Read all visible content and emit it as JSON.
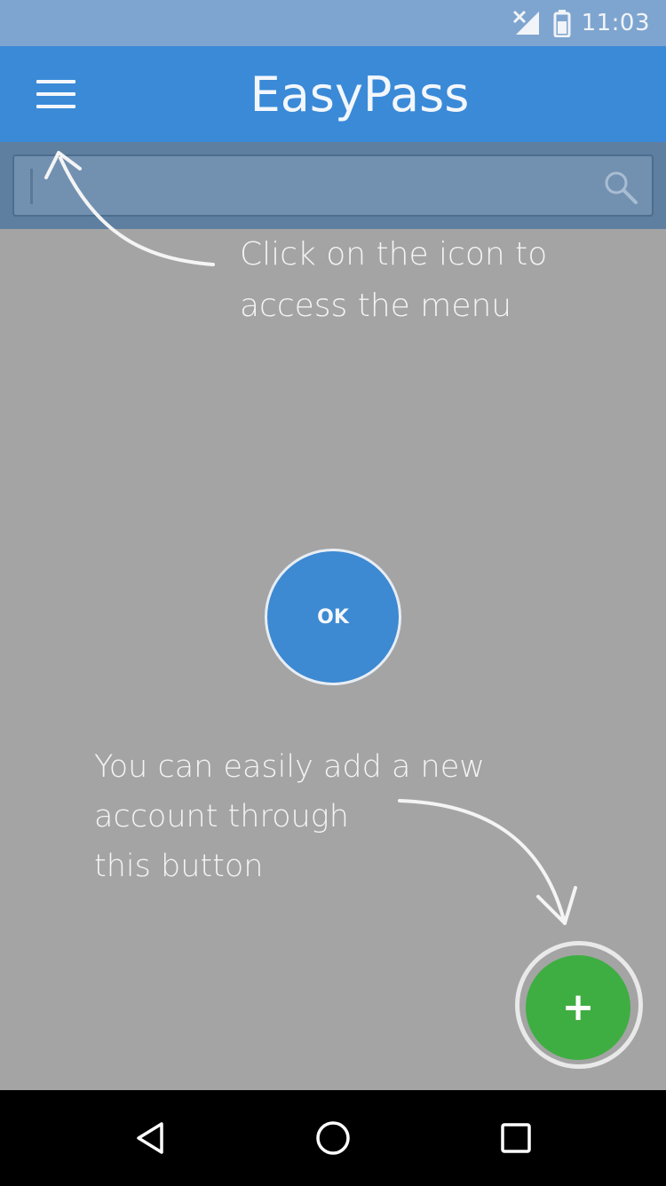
{
  "status_bar": {
    "time": "11:03",
    "icons": [
      "signal-icon",
      "battery-icon"
    ]
  },
  "app_bar": {
    "title": "EasyPass",
    "menu_icon": "hamburger-menu-icon"
  },
  "search": {
    "value": "",
    "icon": "search-icon"
  },
  "tutorial": {
    "menu_hint": "Click on the icon to\naccess the menu",
    "add_hint": "You can easily add a new\naccount through\nthis button",
    "ok_label": "OK"
  },
  "fab": {
    "label": "+",
    "icon": "add-icon"
  },
  "nav_bar": {
    "icons": [
      "back-icon",
      "home-icon",
      "recent-apps-icon"
    ]
  },
  "colors": {
    "status_bar": "#7ea5cf",
    "app_bar": "#3a8ad8",
    "overlay": "#a4a4a4",
    "ok_button": "#3d89d2",
    "fab": "#3fae42",
    "nav_bar": "#000000"
  }
}
